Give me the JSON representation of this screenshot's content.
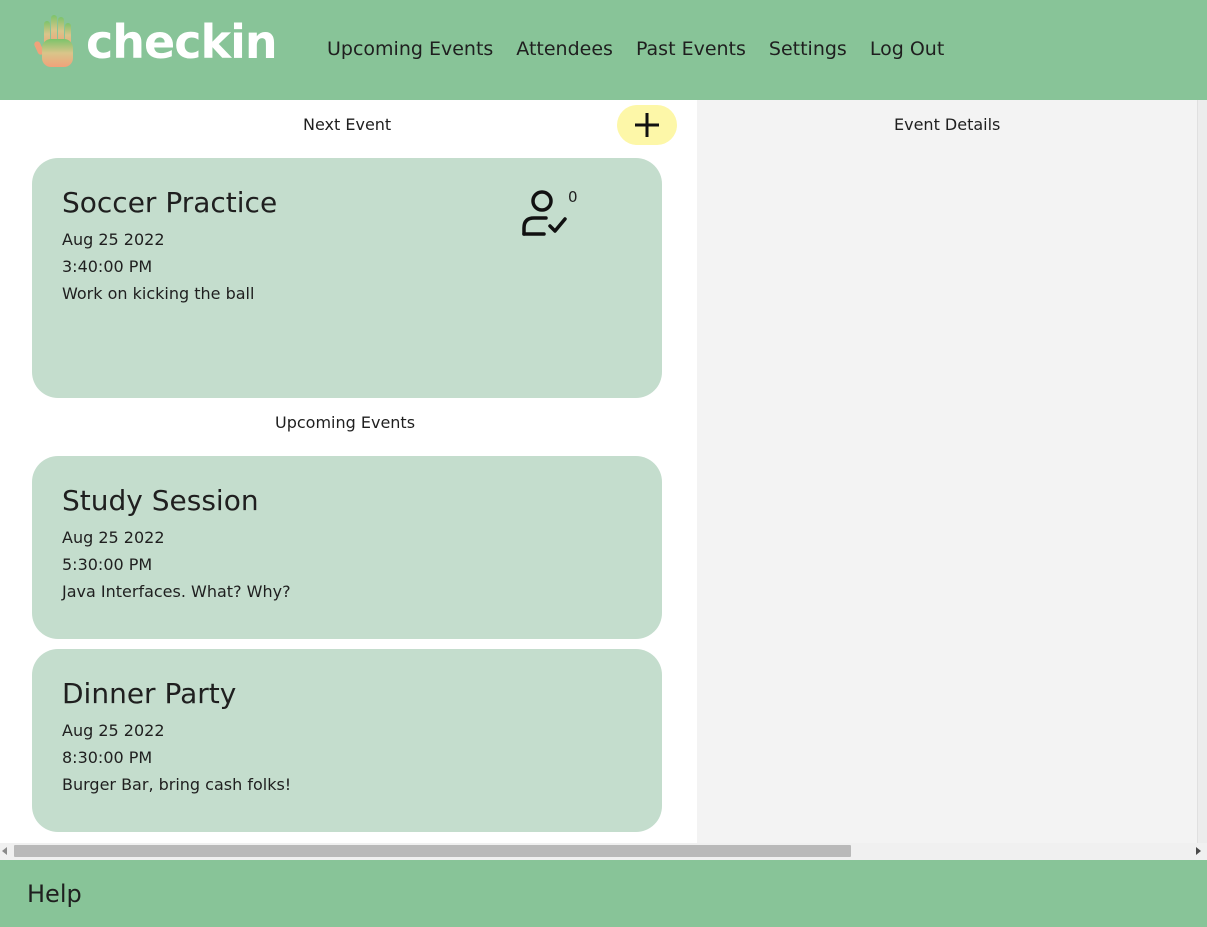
{
  "brand": {
    "name": "checkin",
    "icon": "hand-icon"
  },
  "nav": [
    {
      "label": "Upcoming Events"
    },
    {
      "label": "Attendees"
    },
    {
      "label": "Past Events"
    },
    {
      "label": "Settings"
    },
    {
      "label": "Log Out"
    }
  ],
  "left_panel": {
    "next_event_label": "Next Event",
    "upcoming_label": "Upcoming Events",
    "add_button_icon": "plus-icon"
  },
  "right_panel": {
    "title": "Event Details"
  },
  "next_event": {
    "title": "Soccer Practice",
    "date": "Aug 25 2022",
    "time": "3:40:00 PM",
    "description": "Work on kicking the ball",
    "attendee_icon": "user-check-icon",
    "attendee_count": "0"
  },
  "upcoming_events": [
    {
      "title": "Study Session",
      "date": "Aug 25 2022",
      "time": "5:30:00 PM",
      "description": "Java Interfaces. What? Why?"
    },
    {
      "title": "Dinner Party",
      "date": "Aug 25 2022",
      "time": "8:30:00 PM",
      "description": "Burger Bar, bring cash folks!"
    }
  ],
  "footer": {
    "help_label": "Help"
  },
  "colors": {
    "header": "#88c498",
    "card": "#c4ddcd",
    "add_button": "#fdf7a8",
    "details_panel": "#f3f3f3"
  }
}
